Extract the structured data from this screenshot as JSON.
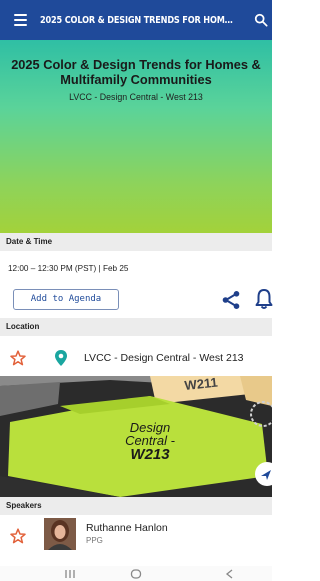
{
  "appbar": {
    "title": "2025 COLOR & DESIGN TRENDS FOR HOME…"
  },
  "hero": {
    "title": "2025 Color & Design Trends for Homes & Multifamily Communities",
    "subtitle": "LVCC - Design Central - West 213"
  },
  "datetime": {
    "heading": "Date & Time",
    "value": "12:00 – 12:30 PM (PST) | Feb 25"
  },
  "actions": {
    "add_to_agenda": "Add to Agenda"
  },
  "location": {
    "heading": "Location",
    "name": "LVCC - Design Central - West 213"
  },
  "map": {
    "label_line1": "Design",
    "label_line2": "Central -",
    "label_line3": "W213",
    "top_label": "W211"
  },
  "speakers": {
    "heading": "Speakers",
    "items": [
      {
        "name": "Ruthanne Hanlon",
        "org": "PPG"
      }
    ]
  },
  "colors": {
    "appbar": "#1f4a9a",
    "accent": "#1f4a9a",
    "star": "#e2613a",
    "pin": "#1aa6a0",
    "map_room": "#b9e03c"
  }
}
